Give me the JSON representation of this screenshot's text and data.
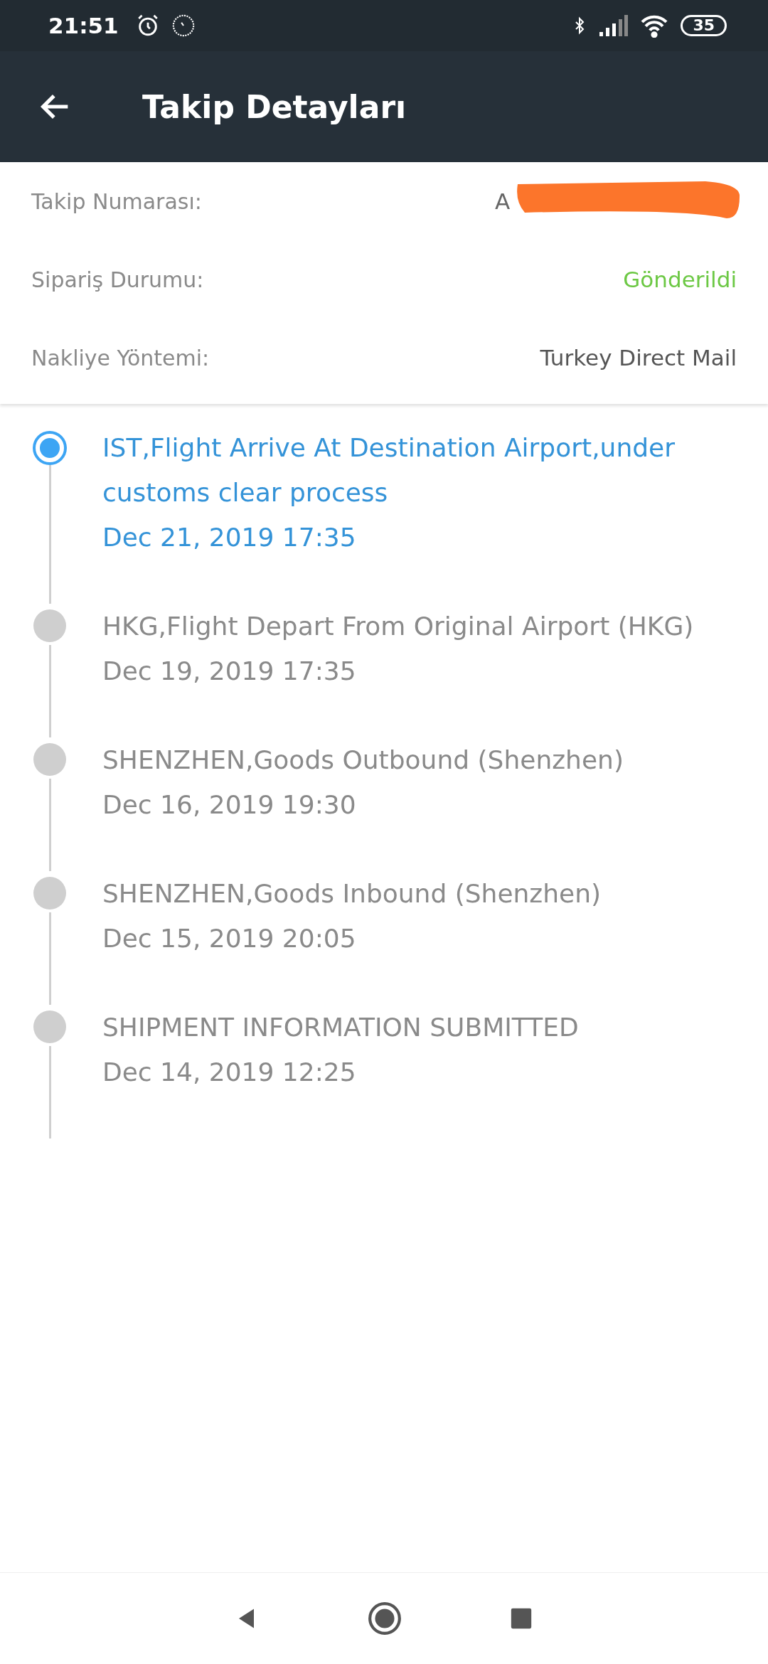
{
  "status_bar": {
    "time": "21:51",
    "battery": "35"
  },
  "app_bar": {
    "title": "Takip Detayları"
  },
  "details": [
    {
      "label": "Takip Numarası:",
      "value": "A",
      "redacted": true,
      "kind": "plain"
    },
    {
      "label": "Sipariş Durumu:",
      "value": "Gönderildi",
      "kind": "status"
    },
    {
      "label": "Nakliye Yöntemi:",
      "value": "Turkey Direct Mail",
      "kind": "plain"
    }
  ],
  "events": [
    {
      "description": "IST,Flight Arrive At Destination Airport,under customs clear process",
      "date": "Dec 21, 2019 17:35",
      "current": true
    },
    {
      "description": "HKG,Flight Depart From Original Airport (HKG)",
      "date": "Dec 19, 2019 17:35",
      "current": false
    },
    {
      "description": "SHENZHEN,Goods Outbound (Shenzhen)",
      "date": "Dec 16, 2019 19:30",
      "current": false
    },
    {
      "description": "SHENZHEN,Goods Inbound (Shenzhen)",
      "date": "Dec 15, 2019 20:05",
      "current": false
    },
    {
      "description": "SHIPMENT INFORMATION SUBMITTED",
      "date": "Dec 14, 2019 12:25",
      "current": false
    }
  ]
}
